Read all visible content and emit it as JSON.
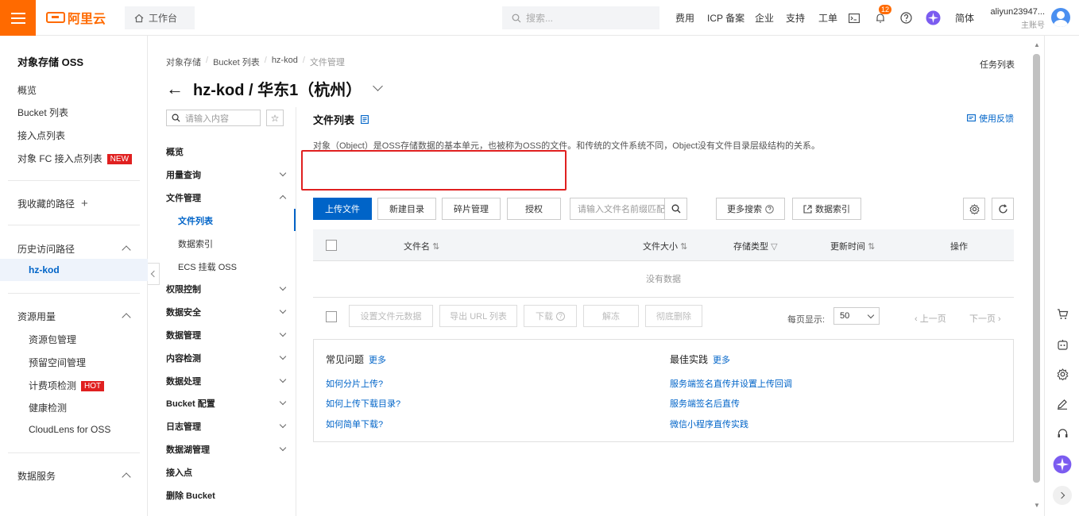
{
  "topbar": {
    "brand": "阿里云",
    "workbench": "工作台",
    "search_placeholder": "搜索...",
    "nav": [
      "费用",
      "ICP 备案",
      "企业",
      "支持",
      "工单"
    ],
    "notif_count": "12",
    "lang": "简体",
    "account_name": "aliyun23947...",
    "account_role": "主账号"
  },
  "sidebar": {
    "title": "对象存储 OSS",
    "items": [
      "概览",
      "Bucket 列表",
      "接入点列表",
      "对象 FC 接入点列表"
    ],
    "new_tag": "NEW",
    "favorites": "我收藏的路径",
    "history": "历史访问路径",
    "history_item": "hz-kod",
    "resource": "资源用量",
    "resource_items": [
      "资源包管理",
      "预留空间管理",
      "计费项检测",
      "健康检测",
      "CloudLens for OSS"
    ],
    "hot_tag": "HOT",
    "data_service": "数据服务"
  },
  "breadcrumb": [
    "对象存储",
    "Bucket 列表",
    "hz-kod",
    "文件管理"
  ],
  "task_list": "任务列表",
  "page_title": "hz-kod / 华东1（杭州）",
  "left_nav": {
    "search_placeholder": "请输入内容",
    "items": [
      {
        "label": "概览",
        "chev": ""
      },
      {
        "label": "用量查询",
        "chev": "down"
      },
      {
        "label": "文件管理",
        "chev": "up"
      },
      {
        "label": "文件列表",
        "sub": true,
        "active": true
      },
      {
        "label": "数据索引",
        "sub": true
      },
      {
        "label": "ECS 挂载 OSS",
        "sub": true
      },
      {
        "label": "权限控制",
        "chev": "down"
      },
      {
        "label": "数据安全",
        "chev": "down"
      },
      {
        "label": "数据管理",
        "chev": "down"
      },
      {
        "label": "内容检测",
        "chev": "down"
      },
      {
        "label": "数据处理",
        "chev": "down"
      },
      {
        "label": "Bucket 配置",
        "chev": "down"
      },
      {
        "label": "日志管理",
        "chev": "down"
      },
      {
        "label": "数据湖管理",
        "chev": "down"
      },
      {
        "label": "接入点",
        "chev": ""
      },
      {
        "label": "删除 Bucket",
        "chev": ""
      }
    ]
  },
  "content": {
    "title": "文件列表",
    "feedback": "使用反馈",
    "description": "对象（Object）是OSS存储数据的基本单元，也被称为OSS的文件。和传统的文件系统不同，Object没有文件目录层级结构的关系。",
    "buttons": {
      "upload": "上传文件",
      "new_dir": "新建目录",
      "fragments": "碎片管理",
      "authorize": "授权",
      "more_search": "更多搜索",
      "data_index": "数据索引"
    },
    "search_placeholder": "请输入文件名前缀匹配",
    "columns": [
      "文件名",
      "文件大小",
      "存储类型",
      "更新时间",
      "操作"
    ],
    "empty": "没有数据",
    "bulk": [
      "设置文件元数据",
      "导出 URL 列表",
      "下载",
      "解冻",
      "彻底删除"
    ],
    "page_size_label": "每页显示:",
    "page_size": "50",
    "prev": "上一页",
    "next": "下一页",
    "faq_title": "常见问题",
    "best_title": "最佳实践",
    "more": "更多",
    "faq_links": [
      "如何分片上传?",
      "如何上传下载目录?",
      "如何简单下载?"
    ],
    "best_links": [
      "服务端签名直传并设置上传回调",
      "服务端签名后直传",
      "微信小程序直传实践"
    ]
  }
}
